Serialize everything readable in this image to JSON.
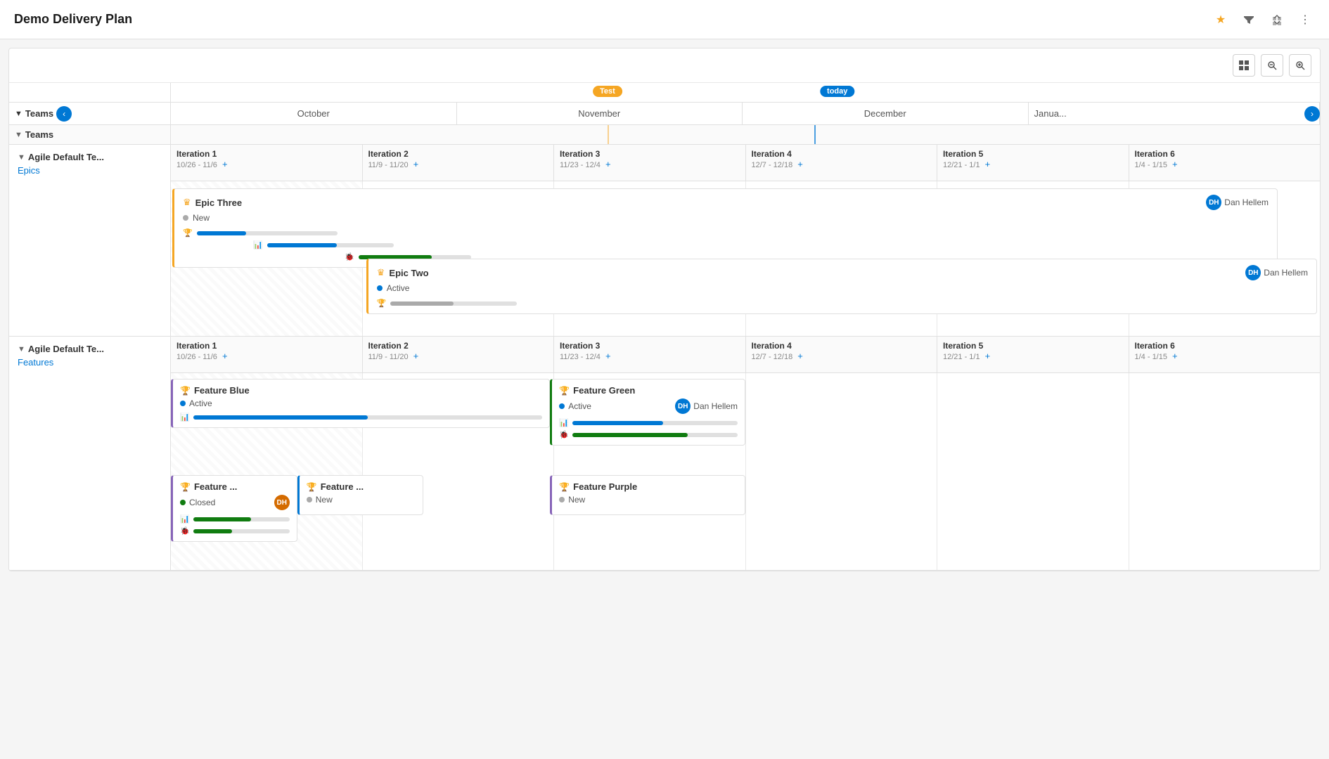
{
  "app": {
    "title": "Demo Delivery Plan"
  },
  "toolbar": {
    "zoom_out_label": "zoom-out",
    "zoom_in_label": "zoom-in",
    "settings_label": "settings"
  },
  "months": [
    "October",
    "November",
    "December",
    "Janua..."
  ],
  "markers": {
    "test_label": "Test",
    "today_label": "today"
  },
  "teams": [
    {
      "name": "Agile Default Te...",
      "type": "Epics",
      "iterations": [
        {
          "name": "Iteration 1",
          "dates": "10/26 - 11/6"
        },
        {
          "name": "Iteration 2",
          "dates": "11/9 - 11/20"
        },
        {
          "name": "Iteration 3",
          "dates": "11/23 - 12/4"
        },
        {
          "name": "Iteration 4",
          "dates": "12/7 - 12/18"
        },
        {
          "name": "Iteration 5",
          "dates": "12/21 - 1/1"
        },
        {
          "name": "Iteration 6",
          "dates": "1/4 - 1/15"
        }
      ],
      "items": [
        {
          "id": "epic-three",
          "title": "Epic Three",
          "status": "New",
          "status_type": "new",
          "assignee": "Dan Hellem",
          "assignee_initials": "DH",
          "bars": [
            {
              "type": "trophy",
              "fill_pct": 35,
              "color": "blue"
            },
            {
              "type": "progress",
              "fill_pct": 55,
              "color": "blue"
            },
            {
              "type": "bug",
              "fill_pct": 65,
              "color": "green"
            }
          ]
        },
        {
          "id": "epic-two",
          "title": "Epic Two",
          "status": "Active",
          "status_type": "active",
          "assignee": "Dan Hellem",
          "assignee_initials": "DH",
          "bars": [
            {
              "type": "trophy",
              "fill_pct": 50,
              "color": "blue"
            }
          ]
        }
      ]
    },
    {
      "name": "Agile Default Te...",
      "type": "Features",
      "iterations": [
        {
          "name": "Iteration 1",
          "dates": "10/26 - 11/6"
        },
        {
          "name": "Iteration 2",
          "dates": "11/9 - 11/20"
        },
        {
          "name": "Iteration 3",
          "dates": "11/23 - 12/4"
        },
        {
          "name": "Iteration 4",
          "dates": "12/7 - 12/18"
        },
        {
          "name": "Iteration 5",
          "dates": "12/21 - 1/1"
        },
        {
          "name": "Iteration 6",
          "dates": "1/4 - 1/15"
        }
      ],
      "features": [
        {
          "id": "feature-blue",
          "title": "Feature Blue",
          "status": "Active",
          "status_type": "active",
          "assignee": null,
          "bars": [
            {
              "type": "progress",
              "fill_pct": 50,
              "color": "blue"
            }
          ],
          "col_start": 1,
          "col_span": 2
        },
        {
          "id": "feature-green",
          "title": "Feature Green",
          "status": "Active",
          "status_type": "active",
          "assignee": "Dan Hellem",
          "assignee_initials": "DH",
          "bars": [
            {
              "type": "progress",
              "fill_pct": 55,
              "color": "blue"
            },
            {
              "type": "bug",
              "fill_pct": 70,
              "color": "green"
            }
          ],
          "col_start": 3,
          "col_span": 1
        },
        {
          "id": "feature-blue-active",
          "title": "Feature ...",
          "status": "Closed",
          "status_type": "closed",
          "assignee_initials": "DH",
          "bars": [
            {
              "type": "progress",
              "fill_pct": 60,
              "color": "blue"
            },
            {
              "type": "bug",
              "fill_pct": 40,
              "color": "green"
            }
          ],
          "col_start": 1,
          "col_span": 1,
          "row": 2
        },
        {
          "id": "feature-mid",
          "title": "Feature ...",
          "status": "New",
          "status_type": "new",
          "assignee": null,
          "bars": [],
          "col_start": 2,
          "col_span": 1,
          "row": 2
        },
        {
          "id": "feature-purple",
          "title": "Feature Purple",
          "status": "New",
          "status_type": "new",
          "assignee": null,
          "bars": [],
          "col_start": 3,
          "col_span": 1,
          "row": 2
        }
      ]
    }
  ]
}
